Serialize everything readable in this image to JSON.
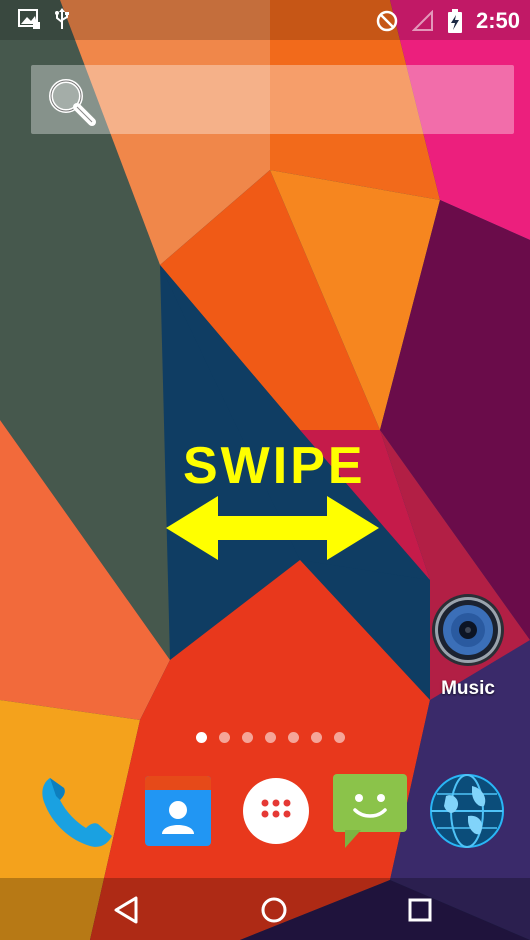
{
  "status_bar": {
    "time": "2:50",
    "icons": [
      "screenshot-icon",
      "usb-icon",
      "do-not-disturb-icon",
      "signal-icon",
      "battery-charging-icon"
    ]
  },
  "search": {
    "placeholder": "",
    "icon": "search-icon"
  },
  "overlay": {
    "swipe_text": "SWIPE",
    "arrow_color": "#ffff00"
  },
  "desktop": {
    "apps": [
      {
        "label": "Music",
        "icon": "music-speaker-icon"
      }
    ]
  },
  "page_indicator": {
    "total": 7,
    "active_index": 0
  },
  "dock": {
    "apps": [
      {
        "name": "Phone",
        "icon": "phone-icon",
        "color": "#1aa1e1"
      },
      {
        "name": "Contacts",
        "icon": "contacts-icon",
        "color": "#2196f3"
      },
      {
        "name": "All apps",
        "icon": "app-drawer-icon",
        "color": "#ffffff"
      },
      {
        "name": "Messaging",
        "icon": "messaging-icon",
        "color": "#8bc34a"
      },
      {
        "name": "Browser",
        "icon": "globe-icon",
        "color": "#29b6f6"
      }
    ]
  },
  "nav_bar": {
    "buttons": [
      "back",
      "home",
      "recents"
    ]
  }
}
